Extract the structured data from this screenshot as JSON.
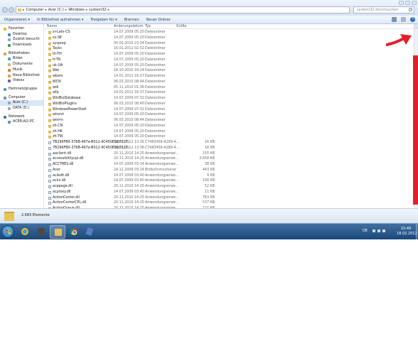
{
  "window": {
    "breadcrumbs": [
      "Computer",
      "Acer (C:)",
      "Windows",
      "system32"
    ],
    "search_placeholder": "system32 durchsuchen"
  },
  "toolbar": {
    "organize": "Organisieren ▾",
    "include_library": "In Bibliothek aufnehmen ▾",
    "share": "Freigeben für ▾",
    "burn": "Brennen",
    "new_folder": "Neuer Ordner",
    "help": "?"
  },
  "nav_pane": {
    "favorites": "Favoriten",
    "desktop": "Desktop",
    "recent": "Zuletzt besucht",
    "downloads": "Downloads",
    "libraries": "Bibliotheken",
    "pictures": "Bilder",
    "documents": "Dokumente",
    "music": "Musik",
    "new_library": "Neue Bibliothek",
    "videos": "Videos",
    "homegroup": "Heimnetzgruppe",
    "computer": "Computer",
    "drive_c": "Acer (C:)",
    "drive_d": "DATA (D:)",
    "network": "Netzwerk",
    "network_pc": "ACER-AI2-PC"
  },
  "file_list": {
    "columns": {
      "name": "Name",
      "date": "Änderungsdatum",
      "type": "Typ",
      "size": "Größe"
    },
    "rows": [
      {
        "kind": "folder",
        "name": "sr-Latn-CS",
        "date": "14.07.2009 05:20",
        "type": "Dateiordner",
        "size": ""
      },
      {
        "kind": "folder",
        "name": "sv-SE",
        "date": "14.07.2009 05:20",
        "type": "Dateiordner",
        "size": ""
      },
      {
        "kind": "folder",
        "name": "sysprep",
        "date": "05.03.2010 23:34",
        "type": "Dateiordner",
        "size": ""
      },
      {
        "kind": "folder",
        "name": "Tasks",
        "date": "16.01.2012 02:52",
        "type": "Dateiordner",
        "size": ""
      },
      {
        "kind": "folder",
        "name": "th-TH",
        "date": "14.07.2009 05:20",
        "type": "Dateiordner",
        "size": ""
      },
      {
        "kind": "folder",
        "name": "tr-TR",
        "date": "14.07.2009 05:20",
        "type": "Dateiordner",
        "size": ""
      },
      {
        "kind": "folder",
        "name": "uk-UA",
        "date": "14.07.2009 05:20",
        "type": "Dateiordner",
        "size": ""
      },
      {
        "kind": "folder",
        "name": "Wat",
        "date": "16.10.2010 18:24",
        "type": "Dateiordner",
        "size": ""
      },
      {
        "kind": "folder",
        "name": "wbem",
        "date": "14.01.2012 16:27",
        "type": "Dateiordner",
        "size": ""
      },
      {
        "kind": "folder",
        "name": "WCN",
        "date": "06.03.2010 08:44",
        "type": "Dateiordner",
        "size": ""
      },
      {
        "kind": "folder",
        "name": "wdi",
        "date": "05.11.2010 01:36",
        "type": "Dateiordner",
        "size": ""
      },
      {
        "kind": "folder",
        "name": "wfp",
        "date": "14.01.2012 16:37",
        "type": "Dateiordner",
        "size": ""
      },
      {
        "kind": "folder",
        "name": "WinBioDatabase",
        "date": "14.07.2009 07:32",
        "type": "Dateiordner",
        "size": ""
      },
      {
        "kind": "folder",
        "name": "WinBioPlugIns",
        "date": "06.03.2010 08:40",
        "type": "Dateiordner",
        "size": ""
      },
      {
        "kind": "folder",
        "name": "WindowsPowerShell",
        "date": "14.07.2009 07:32",
        "type": "Dateiordner",
        "size": ""
      },
      {
        "kind": "folder",
        "name": "winevt",
        "date": "14.07.2009 05:20",
        "type": "Dateiordner",
        "size": ""
      },
      {
        "kind": "folder",
        "name": "winrm",
        "date": "06.03.2010 08:44",
        "type": "Dateiordner",
        "size": ""
      },
      {
        "kind": "folder",
        "name": "zh-CN",
        "date": "14.07.2009 05:20",
        "type": "Dateiordner",
        "size": ""
      },
      {
        "kind": "folder",
        "name": "zh-HK",
        "date": "14.07.2009 05:20",
        "type": "Dateiordner",
        "size": ""
      },
      {
        "kind": "folder",
        "name": "zh-TW",
        "date": "14.07.2009 05:20",
        "type": "Dateiordner",
        "size": ""
      },
      {
        "kind": "file",
        "name": "7B296FB0-376B-497e-B012-9C450E1B7327...",
        "date": "16.02.2012 13:36",
        "type": "C7483456-A289-4...",
        "size": "16 KB"
      },
      {
        "kind": "file",
        "name": "7B296FB0-376B-497e-B012-9C450E1B7327...",
        "date": "16.02.2012 13:36",
        "type": "C7483456-A289-4...",
        "size": "16 KB"
      },
      {
        "kind": "dll",
        "name": "aaclient.dll",
        "date": "20.11.2010 14:25",
        "type": "Anwendungserwe...",
        "size": "155 KB"
      },
      {
        "kind": "dll",
        "name": "accessibilitycpl.dll",
        "date": "20.11.2010 14:25",
        "type": "Anwendungserwe...",
        "size": "3.658 KB"
      },
      {
        "kind": "dll",
        "name": "ACCTRES.dll",
        "date": "14.07.2009 03:14",
        "type": "Anwendungserwe...",
        "size": "38 KB"
      },
      {
        "kind": "file",
        "name": "Acer",
        "date": "24.12.2009 03:24",
        "type": "Bildschirmschoner",
        "size": "443 KB"
      },
      {
        "kind": "dll",
        "name": "acledit.dll",
        "date": "14.07.2009 03:40",
        "type": "Anwendungserwe...",
        "size": "9 KB"
      },
      {
        "kind": "dll",
        "name": "aclui.dll",
        "date": "14.07.2009 03:40",
        "type": "Anwendungserwe...",
        "size": "156 KB"
      },
      {
        "kind": "dll",
        "name": "acppage.dll",
        "date": "20.11.2010 14:25",
        "type": "Anwendungserwe...",
        "size": "52 KB"
      },
      {
        "kind": "dll",
        "name": "acproxy.dll",
        "date": "14.07.2009 03:40",
        "type": "Anwendungserwe...",
        "size": "11 KB"
      },
      {
        "kind": "dll",
        "name": "ActionCenter.dll",
        "date": "20.11.2010 14:25",
        "type": "Anwendungserwe...",
        "size": "763 KB"
      },
      {
        "kind": "dll",
        "name": "ActionCenterCPL.dll",
        "date": "20.11.2010 14:25",
        "type": "Anwendungserwe...",
        "size": "537 KB"
      },
      {
        "kind": "dll",
        "name": "ActionQueue.dll",
        "date": "20.11.2010 14:25",
        "type": "Anwendungserwe...",
        "size": "221 KB"
      }
    ]
  },
  "details_pane": {
    "item_count": "2.683 Elemente"
  },
  "taskbar": {
    "language": "DE",
    "time": "15:49",
    "date": "18.02.2012"
  },
  "colors": {
    "highlight_red": "#e3202a",
    "taskbar_blue": "#1b4878",
    "folder_yellow": "#e4c15c"
  }
}
